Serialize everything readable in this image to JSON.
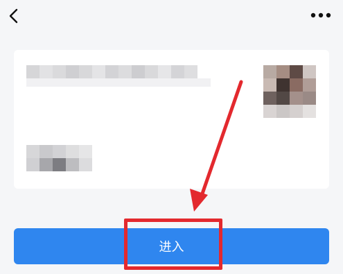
{
  "header": {
    "back_icon": "chevron-left-icon",
    "more_icon": "more-horizontal-icon"
  },
  "card": {
    "title": "",
    "subtitle": "",
    "avatar_icon": "pixelated-avatar"
  },
  "action": {
    "enter_label": "进入"
  },
  "colors": {
    "button_blue": "#2f86ef",
    "annotation_red": "#e3292e",
    "background": "#f5f6f8"
  }
}
